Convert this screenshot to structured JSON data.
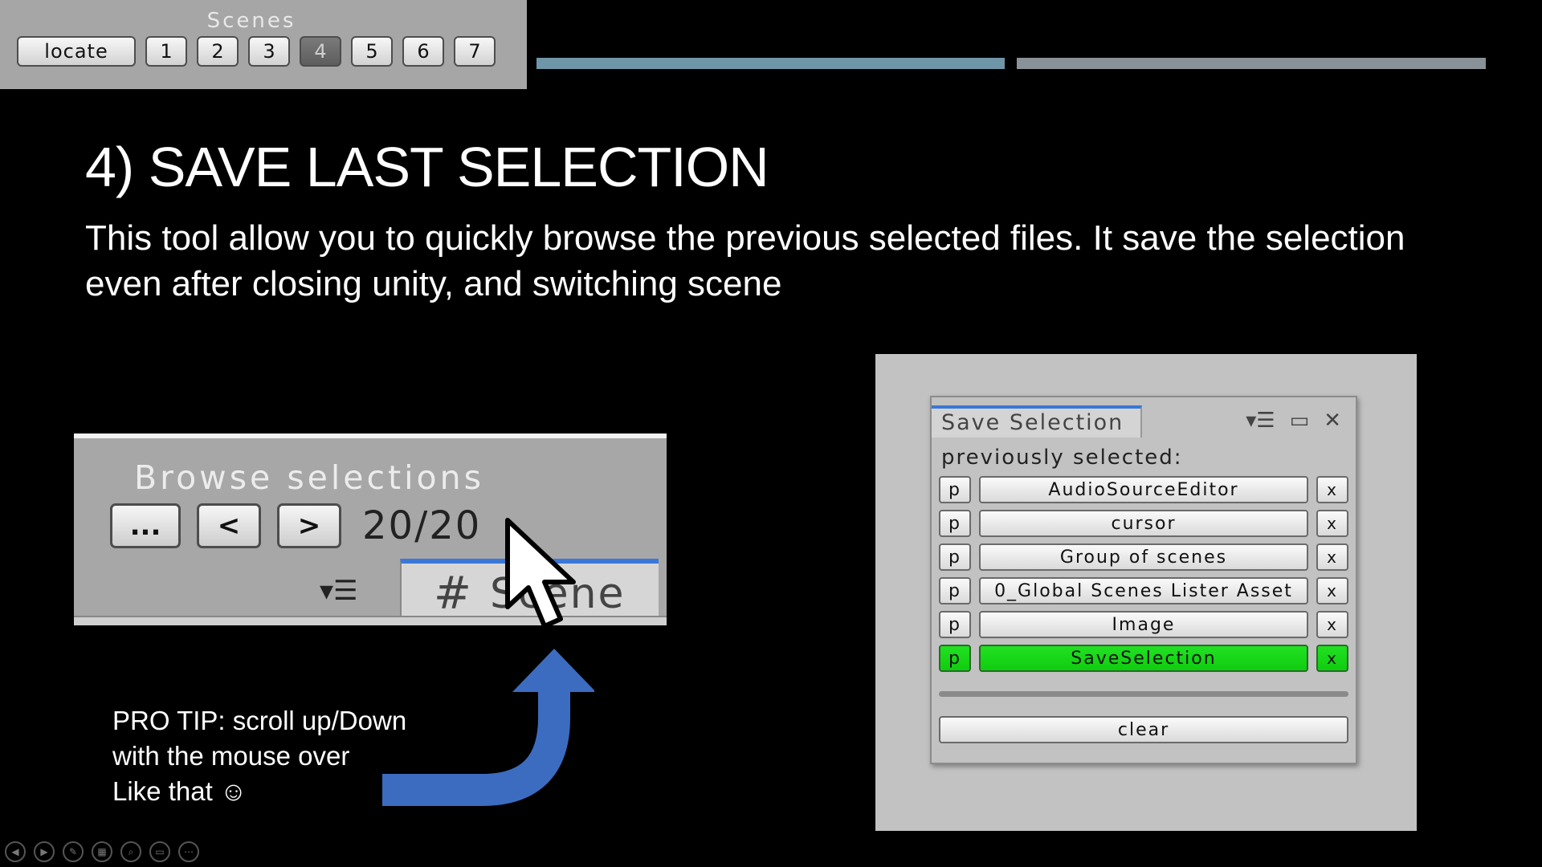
{
  "scenes_panel": {
    "title": "Scenes",
    "locate_label": "locate",
    "buttons": [
      "1",
      "2",
      "3",
      "4",
      "5",
      "6",
      "7"
    ],
    "active_button": "4"
  },
  "progress": {
    "segments": [
      {
        "state": "current",
        "color": "#6f95a8"
      },
      {
        "state": "upcoming",
        "color": "#8a9299"
      }
    ]
  },
  "slide": {
    "title": "4) SAVE LAST SELECTION",
    "description": "This tool allow you to quickly browse the previous selected files. It save the selection even after closing unity, and switching scene"
  },
  "browse": {
    "title": "Browse selections",
    "more_label": "...",
    "prev_label": "<",
    "next_label": ">",
    "counter": "20/20",
    "menu_glyph": "▾☰",
    "tab_icon": "#",
    "tab_label_partial": "Scene"
  },
  "protip": {
    "lines": [
      "PRO TIP: scroll up/Down",
      "with the mouse over",
      "Like that ☺"
    ]
  },
  "save_window": {
    "tab_label": "Save Selection",
    "menu_glyph": "▾☰",
    "maximize_glyph": "▭",
    "close_glyph": "✕",
    "section_label": "previously selected:",
    "p_label": "p",
    "x_label": "x",
    "items": [
      {
        "name": "AudioSourceEditor",
        "highlighted": false
      },
      {
        "name": "cursor",
        "highlighted": false
      },
      {
        "name": "Group of scenes",
        "highlighted": false
      },
      {
        "name": "0_Global Scenes Lister Asset",
        "highlighted": false
      },
      {
        "name": "Image",
        "highlighted": false
      },
      {
        "name": "SaveSelection",
        "highlighted": true
      }
    ],
    "clear_label": "clear",
    "highlight_color": "#1ad61a"
  },
  "slideshow_controls": {
    "icons": [
      "prev-icon",
      "next-icon",
      "pen-icon",
      "slides-icon",
      "zoom-icon",
      "subtitles-icon",
      "more-icon"
    ],
    "glyphs": [
      "◀",
      "▶",
      "✎",
      "▦",
      "⌕",
      "▭",
      "⋯"
    ]
  }
}
